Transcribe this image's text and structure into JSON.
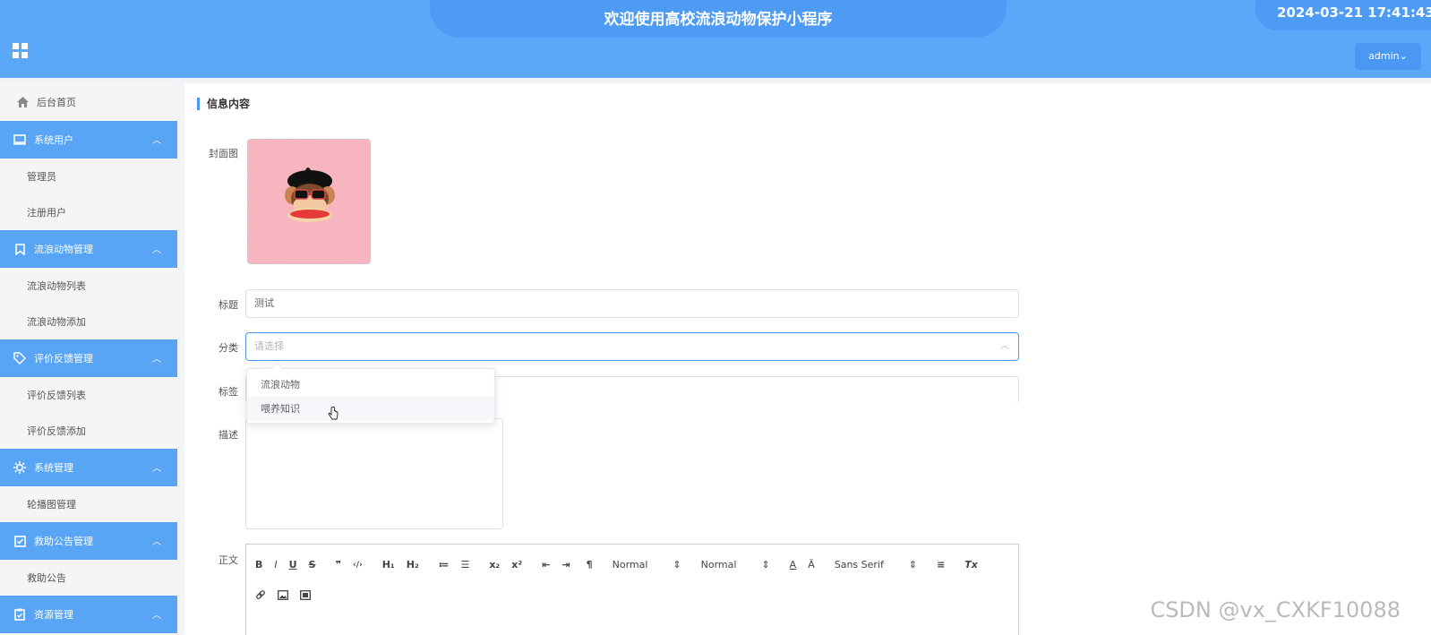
{
  "header": {
    "title": "欢迎使用高校流浪动物保护小程序",
    "datetime": "2024-03-21 17:41:43",
    "user_button": "admin",
    "user_chevron": "⌄"
  },
  "sidebar": {
    "home": "后台首页",
    "groups": [
      {
        "label": "系统用户",
        "icon": "monitor-icon",
        "items": [
          "管理员",
          "注册用户"
        ]
      },
      {
        "label": "流浪动物管理",
        "icon": "bookmark-icon",
        "items": [
          "流浪动物列表",
          "流浪动物添加"
        ]
      },
      {
        "label": "评价反馈管理",
        "icon": "tag-icon",
        "items": [
          "评价反馈列表",
          "评价反馈添加"
        ]
      },
      {
        "label": "系统管理",
        "icon": "gear-icon",
        "items": [
          "轮播图管理"
        ]
      },
      {
        "label": "救助公告管理",
        "icon": "checkbox-icon",
        "items": [
          "救助公告"
        ]
      },
      {
        "label": "资源管理",
        "icon": "clipboard-icon",
        "items": []
      }
    ]
  },
  "form": {
    "section_title": "信息内容",
    "cover_label": "封面图",
    "title_label": "标题",
    "title_value": "测试",
    "category_label": "分类",
    "category_placeholder": "请选择",
    "tags_label": "标签",
    "desc_label": "描述",
    "body_label": "正文",
    "category_options": [
      "流浪动物",
      "喂养知识"
    ],
    "hovered_option_index": 1
  },
  "editor": {
    "row1": [
      "B",
      "I",
      "U",
      "S",
      "❞",
      "‹/›",
      "H₁",
      "H₂",
      "≔",
      "☰",
      "x₂",
      "x²",
      "⇤",
      "⇥",
      "¶",
      "Normal",
      "Normal",
      "A",
      "Ā",
      "Sans Serif",
      "≡",
      "Tx"
    ],
    "size_select": "Normal",
    "header_select": "Normal",
    "font_select": "Sans Serif"
  },
  "watermark": "CSDN @vx_CXKF10088",
  "colors": {
    "header": "#5aa8f7",
    "accent": "#4b98f2",
    "cover_bg": "#f7b5c0"
  }
}
